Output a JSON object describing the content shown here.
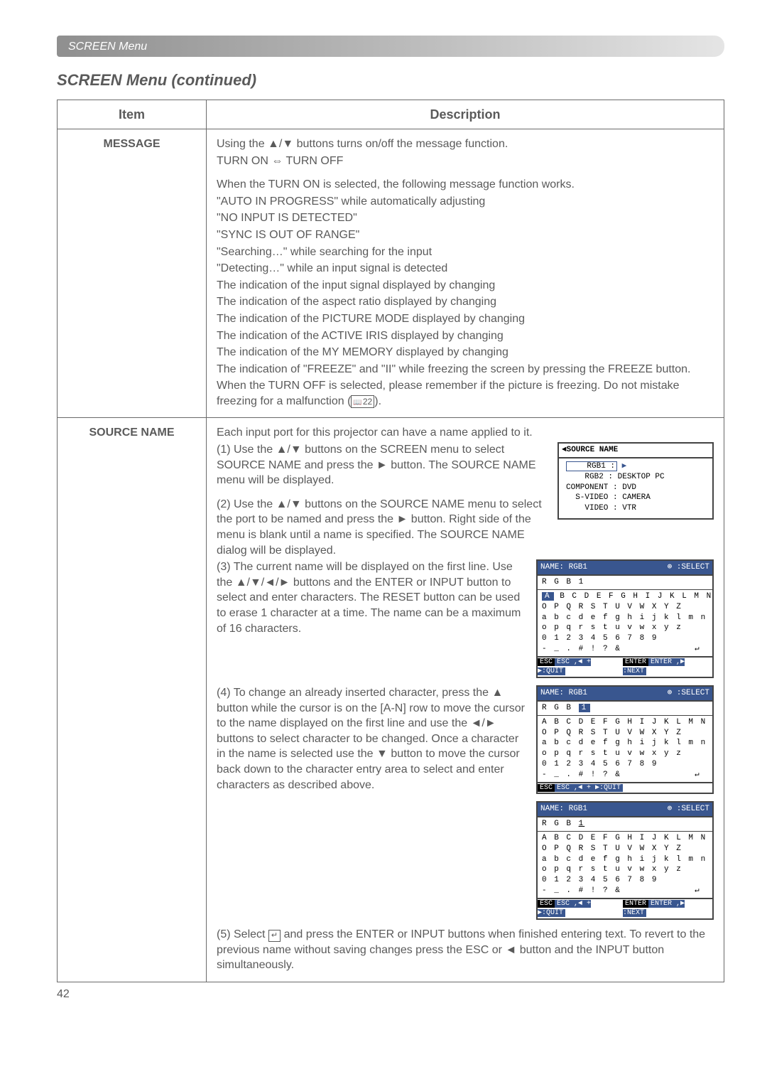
{
  "header": "SCREEN Menu",
  "section_title": "SCREEN Menu (continued)",
  "table": {
    "head": {
      "item": "Item",
      "desc": "Description"
    }
  },
  "message": {
    "item": "MESSAGE",
    "l1a": "Using the ",
    "l1b": " buttons turns on/off the message function.",
    "toggle_a": "TURN ON ",
    "toggle_b": " TURN OFF",
    "l2": "When the TURN ON is selected, the following message function works.",
    "b1": "\"AUTO IN PROGRESS\" while automatically adjusting",
    "b2": "\"NO INPUT IS DETECTED\"",
    "b3": "\"SYNC IS OUT OF RANGE\"",
    "b4": "\"Searching…\" while searching for the input",
    "b5": "\"Detecting…\" while an input signal is detected",
    "b6": "The indication of the input signal displayed by changing",
    "b7": "The indication of the aspect ratio displayed by changing",
    "b8": "The indication of the PICTURE MODE displayed by changing",
    "b9": "The indication of the ACTIVE IRIS displayed by changing",
    "b10": "The indication of the MY MEMORY displayed by changing",
    "b11": "The indication of \"FREEZE\" and \"II\" while freezing the screen by pressing the FREEZE button.",
    "b12a": "When the TURN OFF is selected, please remember if the picture is freezing. Do not mistake freezing for a malfunction (",
    "b12ref": "22",
    "b12b": ")."
  },
  "source": {
    "item": "SOURCE NAME",
    "l0": "Each input port for this projector can have a name applied to it.",
    "s1a": "(1) Use the ",
    "s1b": " buttons on the SCREEN menu to select SOURCE NAME and press the ",
    "s1c": " button. The SOURCE NAME menu will be displayed.",
    "s2a": "(2) Use the ",
    "s2b": " buttons on the SOURCE NAME menu to select the port to be named and press the ",
    "s2c": " button. Right side of the menu is blank until a name is specified. The SOURCE NAME dialog will be displayed.",
    "s3a": "(3) The current name will be displayed on the first line. Use the ",
    "s3b": " buttons and the ENTER or INPUT button to select and enter characters. The RESET button can be used to erase 1 character at a time. The name can be a maximum of 16 characters.",
    "s4a": "(4) To change an already inserted character, press the ",
    "s4b": " button while the cursor is on the [A-N] row to move the cursor to the name displayed on the first line and use the ",
    "s4c": " buttons to select character to be changed. Once a character in the name is selected use the ",
    "s4d": " button to move the cursor back down to the character entry area to select and enter characters as described above.",
    "s5a": "(5) Select ",
    "s5sym": "↵",
    "s5b": " and press the ENTER or INPUT buttons when finished entering text. To revert to the previous name without saving changes press the ESC or ",
    "s5c": " button and the INPUT button simultaneously."
  },
  "osd1": {
    "title": "◄SOURCE NAME",
    "rows": [
      "    RGB1 :",
      "    RGB2 : DESKTOP PC",
      "COMPONENT : DVD",
      "  S-VIDEO : CAMERA",
      "    VIDEO : VTR"
    ]
  },
  "osd2": {
    "title_l": "NAME: RGB1",
    "title_r": "⊕ :SELECT",
    "name": "R G B 1",
    "rows": [
      "A B C D E F G H I J K L M N",
      "O P Q R S T U V W X Y Z",
      "a b c d e f g h i j k l m n",
      "o p q r s t u v w x y z",
      "0 1 2 3 4 5 6 7 8 9",
      "- _ . # ! ? &            ↵"
    ],
    "foot_l": "ESC ,◄ + ▶:QUIT",
    "foot_r": "ENTER ,▶ :NEXT"
  },
  "osd3": {
    "title_l": "NAME: RGB1",
    "title_r": "⊕ :SELECT",
    "name": "R G B 1",
    "rows": [
      "A B C D E F G H I J K L M N",
      "O P Q R S T U V W X Y Z",
      "a b c d e f g h i j k l m n",
      "o p q r s t u v w x y z",
      "0 1 2 3 4 5 6 7 8 9",
      "- _ . # ! ? &            ↵"
    ],
    "foot_l": "ESC ,◄ + ▶:QUIT",
    "foot_r": ""
  },
  "osd4": {
    "title_l": "NAME: RGB1",
    "title_r": "⊕ :SELECT",
    "name": "R G B 1",
    "rows": [
      "A B C D E F G H I J K L M N",
      "O P Q R S T U V W X Y Z",
      "a b c d e f g h i j k l m n",
      "o p q r s t u v w x y z",
      "0 1 2 3 4 5 6 7 8 9",
      "- _ . # ! ? &            ↵"
    ],
    "foot_l": "ESC ,◄ + ▶:QUIT",
    "foot_r": "ENTER ,▶ :NEXT"
  },
  "page_number": "42"
}
